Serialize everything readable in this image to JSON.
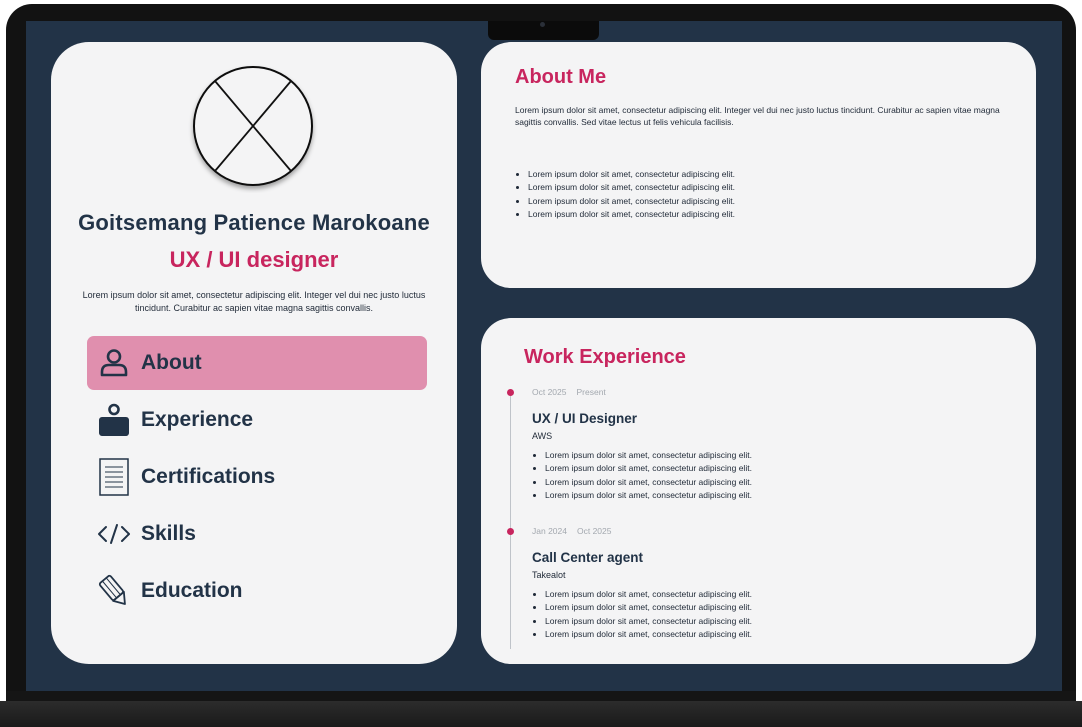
{
  "profile": {
    "name": "Goitsemang Patience Marokoane",
    "role": "UX / UI designer",
    "bio": "Lorem ipsum dolor sit amet, consectetur adipiscing elit. Integer vel dui nec justo luctus tincidunt. Curabitur ac sapien vitae magna sagittis convallis."
  },
  "nav": {
    "items": [
      {
        "label": "About",
        "icon": "person-icon",
        "active": true
      },
      {
        "label": "Experience",
        "icon": "briefcase-person-icon",
        "active": false
      },
      {
        "label": "Certifications",
        "icon": "document-icon",
        "active": false
      },
      {
        "label": "Skills",
        "icon": "code-icon",
        "active": false
      },
      {
        "label": "Education",
        "icon": "pencil-icon",
        "active": false
      }
    ]
  },
  "about": {
    "title": "About Me",
    "text": "Lorem ipsum dolor sit amet, consectetur adipiscing elit. Integer vel dui nec justo luctus tincidunt. Curabitur ac sapien vitae magna sagittis convallis. Sed vitae lectus ut felis vehicula facilisis.",
    "bullets": [
      "Lorem ipsum dolor sit amet, consectetur adipiscing elit.",
      "Lorem ipsum dolor sit amet, consectetur adipiscing elit.",
      "Lorem ipsum dolor sit amet, consectetur adipiscing elit.",
      "Lorem ipsum dolor sit amet, consectetur adipiscing elit."
    ]
  },
  "work": {
    "title": "Work Experience",
    "jobs": [
      {
        "start": "Oct 2025",
        "end": "Present",
        "title": "UX / UI Designer",
        "company": "AWS",
        "bullets": [
          "Lorem ipsum dolor sit amet, consectetur adipiscing elit.",
          "Lorem ipsum dolor sit amet, consectetur adipiscing elit.",
          "Lorem ipsum dolor sit amet, consectetur adipiscing elit.",
          "Lorem ipsum dolor sit amet, consectetur adipiscing elit."
        ]
      },
      {
        "start": "Jan 2024",
        "end": "Oct 2025",
        "title": "Call Center agent",
        "company": "Takealot",
        "bullets": [
          "Lorem ipsum dolor sit amet, consectetur adipiscing elit.",
          "Lorem ipsum dolor sit amet, consectetur adipiscing elit.",
          "Lorem ipsum dolor sit amet, consectetur adipiscing elit.",
          "Lorem ipsum dolor sit amet, consectetur adipiscing elit."
        ]
      }
    ]
  },
  "colors": {
    "background": "#223347",
    "accent": "#c8255e",
    "nav_active": "#e08fae",
    "card": "#f4f4f5",
    "text_dark": "#223347"
  }
}
